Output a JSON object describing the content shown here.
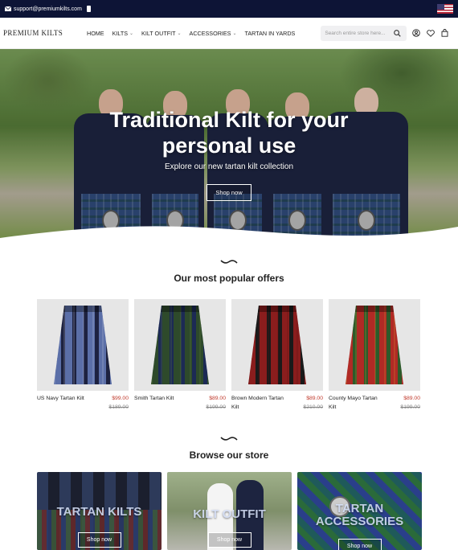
{
  "topbar": {
    "email": "support@premiumkilts.com"
  },
  "header": {
    "logo": "PREMIUM KILTS",
    "nav": [
      {
        "label": "HOME",
        "has_dropdown": false
      },
      {
        "label": "KILTS",
        "has_dropdown": true
      },
      {
        "label": "KILT OUTFIT",
        "has_dropdown": true
      },
      {
        "label": "ACCESSORIES",
        "has_dropdown": true
      },
      {
        "label": "TARTAN IN YARDS",
        "has_dropdown": false
      }
    ],
    "search_placeholder": "Search entire store here...",
    "icons": [
      "user-icon",
      "heart-icon",
      "bag-icon"
    ]
  },
  "hero": {
    "title_line1": "Traditional Kilt for your",
    "title_line2": "personal use",
    "subtitle": "Explore our new tartan kilt collection",
    "button": "Shop now"
  },
  "popular": {
    "title": "Our most popular offers",
    "products": [
      {
        "name": "US Navy Tartan Kilt",
        "price": "$99.00",
        "old_price": "$189.00",
        "colors": [
          "#5b6fa8",
          "#1d2240",
          "#c9cde0"
        ]
      },
      {
        "name": "Smith Tartan Kilt",
        "price": "$89.00",
        "old_price": "$199.00",
        "colors": [
          "#2e4a2b",
          "#1c2a55",
          "#6b8a3a"
        ]
      },
      {
        "name": "Brown Modern Tartan Kilt",
        "price": "$89.00",
        "old_price": "$210.00",
        "colors": [
          "#8a1d1d",
          "#1a1a1a",
          "#5a1010"
        ]
      },
      {
        "name": "County Mayo Tartan Kilt",
        "price": "$89.00",
        "old_price": "$199.00",
        "colors": [
          "#b02a25",
          "#2d5a2a",
          "#d7a533"
        ]
      }
    ]
  },
  "browse": {
    "title": "Browse our store",
    "categories": [
      {
        "label": "TARTAN KILTS",
        "button": "Shop now"
      },
      {
        "label": "KILT OUTFIT",
        "button": "Shop now"
      },
      {
        "label": "TARTAN ACCESSORIES",
        "button": "Shop now"
      }
    ]
  },
  "colors": {
    "topbar": "#0d1436",
    "price": "#c0392b",
    "old_price": "#888888"
  }
}
